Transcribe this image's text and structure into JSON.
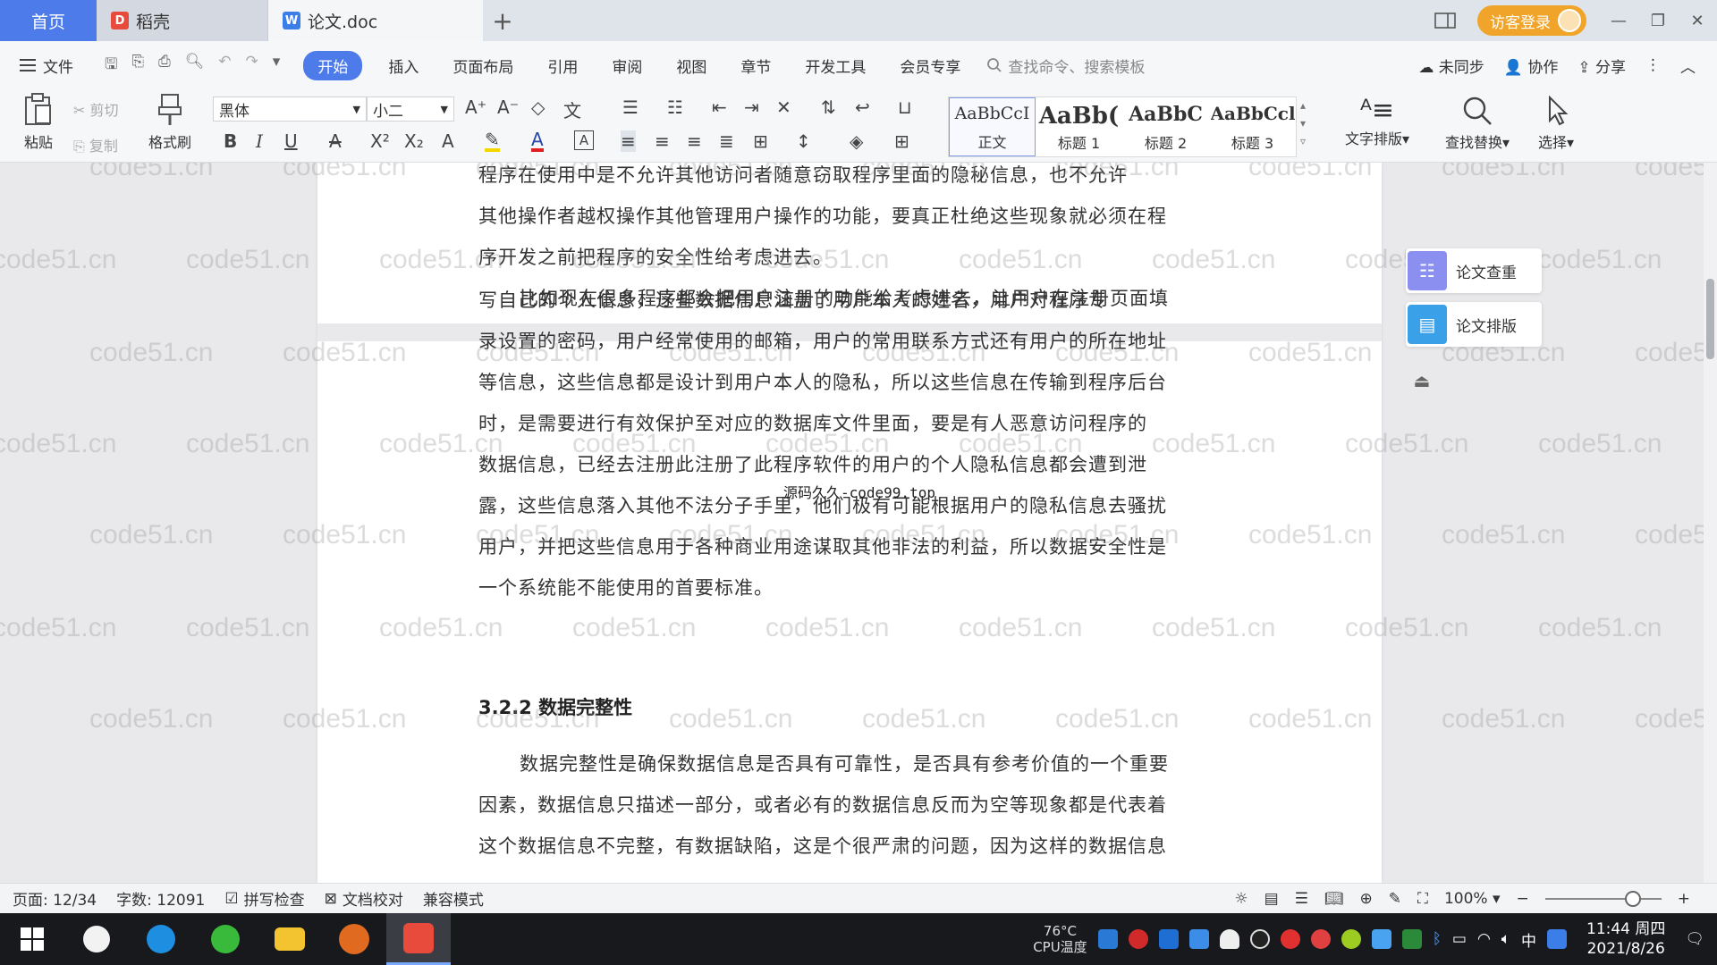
{
  "tabs": {
    "home": "首页",
    "daoke": "稻壳",
    "doc": "论文.doc",
    "add": "+"
  },
  "titlebar": {
    "visitor": "访客登录"
  },
  "menu": {
    "file": "文件",
    "items": [
      "开始",
      "插入",
      "页面布局",
      "引用",
      "审阅",
      "视图",
      "章节",
      "开发工具",
      "会员专享"
    ],
    "search": "查找命令、搜索模板",
    "sync": "未同步",
    "collab": "协作",
    "share": "分享"
  },
  "ribbon": {
    "paste": "粘贴",
    "cut": "剪切",
    "copy": "复制",
    "format_painter": "格式刷",
    "font_name": "黑体",
    "font_size": "小二",
    "styles": [
      {
        "sample": "AaBbCcI",
        "label": "正文"
      },
      {
        "sample": "AaBb(",
        "label": "标题 1"
      },
      {
        "sample": "AaBbC",
        "label": "标题 2"
      },
      {
        "sample": "AaBbCcl",
        "label": "标题 3"
      }
    ],
    "text_layout": "文字排版",
    "find_replace": "查找替换",
    "select": "选择"
  },
  "document": {
    "page1_lines": [
      "程序在使用中是不允许其他访问者随意窃取程序里面的隐秘信息，也不允许",
      "其他操作者越权操作其他管理用户操作的功能，要真正杜绝这些现象就必须在程",
      "序开发之前把程序的安全性给考虑进去。",
      "比如现在很多程序都会把用户注册的功能给考虑进去，让用户在注册页面填"
    ],
    "page2_lines": [
      "写自己的个人信息，这些数据信息涵盖了用户本人的姓名，用户对程序专",
      "录设置的密码，用户经常使用的邮箱，用户的常用联系方式还有用户的所在地址",
      "等信息，这些信息都是设计到用户本人的隐私，所以这些信息在传输到程序后台",
      "时，是需要进行有效保护至对应的数据库文件里面，要是有人恶意访问程序的",
      "数据信息，已经去注册此注册了此程序软件的用户的个人隐私信息都会遭到泄",
      "露，这些信息落入其他不法分子手里，他们极有可能根据用户的隐私信息去骚扰",
      "用户，并把这些信息用于各种商业用途谋取其他非法的利益，所以数据安全性是",
      "一个系统能不能使用的首要标准。"
    ],
    "overlay_text": "源码久久-code99.top",
    "heading": "3.2.2  数据完整性",
    "section_lines": [
      "数据完整性是确保数据信息是否具有可靠性，是否具有参考价值的一个重要",
      "因素，数据信息只描述一部分，或者必有的数据信息反而为空等现象都是代表着",
      "这个数据信息不完整，有数据缺陷，这是个很严肃的问题，因为这样的数据信息"
    ],
    "watermark": "code51.cn"
  },
  "side_panel": {
    "check": "论文查重",
    "layout": "论文排版"
  },
  "statusbar": {
    "page": "页面: 12/34",
    "words": "字数: 12091",
    "spell": "拼写检查",
    "proof": "文档校对",
    "compat": "兼容模式",
    "zoom": "100%",
    "zoom_level": 0.75
  },
  "taskbar": {
    "cpu_temp": "76°C",
    "cpu_label": "CPU温度",
    "ime": "中",
    "time": "11:44 周四",
    "date": "2021/8/26"
  },
  "colors": {
    "accent": "#4e7bea",
    "visitor": "#f0a42a",
    "wps_red": "#e84a3b"
  }
}
